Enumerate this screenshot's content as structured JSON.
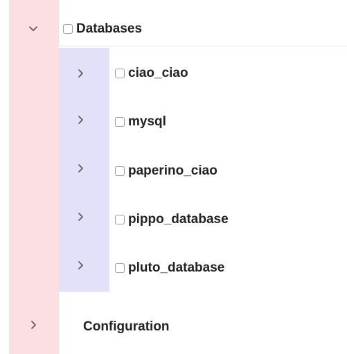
{
  "tree": {
    "root": {
      "label": "Databases",
      "expanded": true,
      "checked": false
    },
    "children": [
      {
        "label": "ciao_ciao",
        "expanded": false,
        "checked": false
      },
      {
        "label": "mysql",
        "expanded": false,
        "checked": false
      },
      {
        "label": "paperino_ciao",
        "expanded": false,
        "checked": false
      },
      {
        "label": "pippo_database",
        "expanded": false,
        "checked": false
      },
      {
        "label": "pluto_database",
        "expanded": false,
        "checked": false
      }
    ],
    "sibling": {
      "label": "Configuration",
      "expanded": false
    }
  },
  "colors": {
    "level0_indent": "#fcdfe2",
    "level1_indent": "#e1e2f9",
    "text": "#222222",
    "checkbox_border": "#9a9aa0",
    "divider": "#e4e4e8"
  },
  "icons": {
    "expanded": "chevron-down-icon",
    "collapsed": "chevron-right-icon"
  }
}
